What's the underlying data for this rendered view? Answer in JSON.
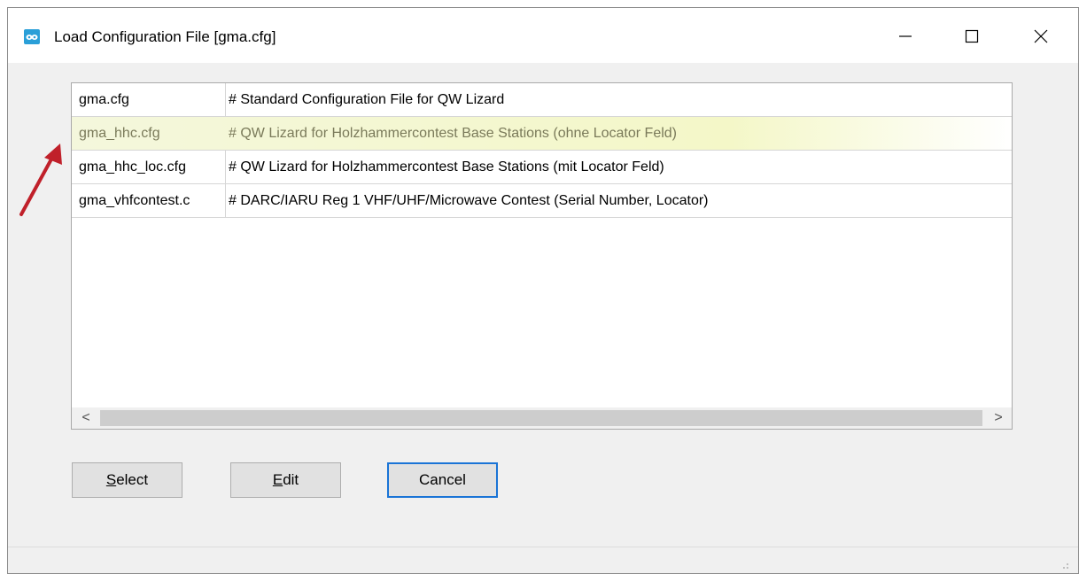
{
  "window": {
    "title": "Load Configuration File [gma.cfg]",
    "controls": {
      "minimize": "minimize",
      "maximize": "maximize",
      "close": "close"
    }
  },
  "file_list": {
    "rows": [
      {
        "file": "gma.cfg",
        "description": "# Standard Configuration File for QW Lizard",
        "highlighted": false
      },
      {
        "file": "gma_hhc.cfg",
        "description": "# QW Lizard for Holzhammercontest Base Stations (ohne Locator Feld)",
        "highlighted": true
      },
      {
        "file": "gma_hhc_loc.cfg",
        "description": "# QW Lizard for Holzhammercontest Base Stations (mit Locator Feld)",
        "highlighted": false
      },
      {
        "file": "gma_vhfcontest.c",
        "description": "# DARC/IARU Reg 1 VHF/UHF/Microwave Contest (Serial Number, Locator)",
        "highlighted": false
      }
    ],
    "scroll_left": "<",
    "scroll_right": ">"
  },
  "buttons": {
    "select_first": "S",
    "select_rest": "elect",
    "edit_first": "E",
    "edit_rest": "dit",
    "cancel": "Cancel"
  },
  "colors": {
    "highlight_row": "#f4f7c8",
    "annotation_arrow": "#c0202a",
    "app_icon": "#2a9fd8",
    "default_button_border": "#1a74d6"
  },
  "icons": {
    "app": "app-icon",
    "annotation": "red-arrow-icon"
  }
}
